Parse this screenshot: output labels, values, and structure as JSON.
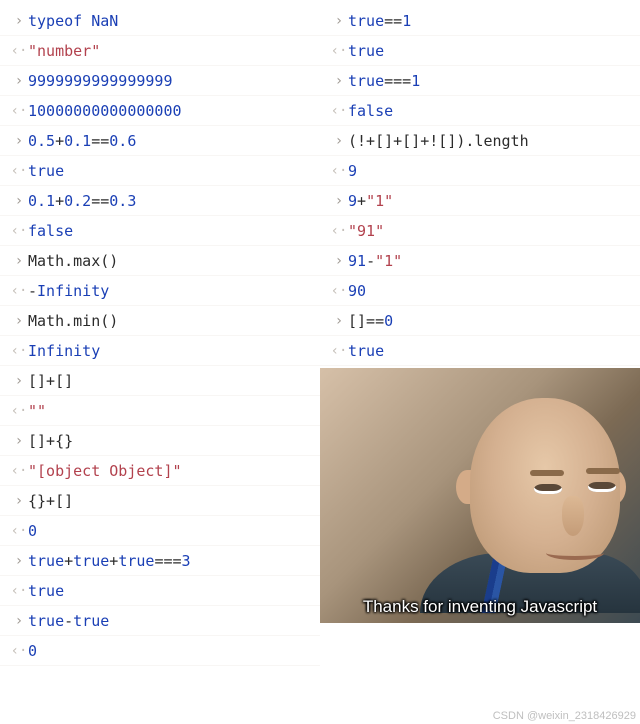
{
  "left": [
    {
      "kind": "in",
      "segments": [
        {
          "t": "kw",
          "v": "typeof"
        },
        {
          "t": "plain",
          "v": " "
        },
        {
          "t": "bool",
          "v": "NaN"
        }
      ]
    },
    {
      "kind": "out",
      "segments": [
        {
          "t": "str",
          "v": "\"number\""
        }
      ]
    },
    {
      "kind": "in",
      "segments": [
        {
          "t": "num",
          "v": "9999999999999999"
        }
      ]
    },
    {
      "kind": "out",
      "segments": [
        {
          "t": "num",
          "v": "10000000000000000"
        }
      ]
    },
    {
      "kind": "in",
      "segments": [
        {
          "t": "num",
          "v": "0.5"
        },
        {
          "t": "plain",
          "v": "+"
        },
        {
          "t": "num",
          "v": "0.1"
        },
        {
          "t": "plain",
          "v": "=="
        },
        {
          "t": "num",
          "v": "0.6"
        }
      ]
    },
    {
      "kind": "out",
      "segments": [
        {
          "t": "bool",
          "v": "true"
        }
      ]
    },
    {
      "kind": "in",
      "segments": [
        {
          "t": "num",
          "v": "0.1"
        },
        {
          "t": "plain",
          "v": "+"
        },
        {
          "t": "num",
          "v": "0.2"
        },
        {
          "t": "plain",
          "v": "=="
        },
        {
          "t": "num",
          "v": "0.3"
        }
      ]
    },
    {
      "kind": "out",
      "segments": [
        {
          "t": "bool",
          "v": "false"
        }
      ]
    },
    {
      "kind": "in",
      "segments": [
        {
          "t": "plain",
          "v": "Math.max()"
        }
      ]
    },
    {
      "kind": "out",
      "segments": [
        {
          "t": "plain",
          "v": "-"
        },
        {
          "t": "bool",
          "v": "Infinity"
        }
      ]
    },
    {
      "kind": "in",
      "segments": [
        {
          "t": "plain",
          "v": "Math.min()"
        }
      ]
    },
    {
      "kind": "out",
      "segments": [
        {
          "t": "bool",
          "v": "Infinity"
        }
      ]
    },
    {
      "kind": "in",
      "segments": [
        {
          "t": "plain",
          "v": "[]+[]"
        }
      ]
    },
    {
      "kind": "out",
      "segments": [
        {
          "t": "str",
          "v": "\"\""
        }
      ]
    },
    {
      "kind": "in",
      "segments": [
        {
          "t": "plain",
          "v": "[]+{}"
        }
      ]
    },
    {
      "kind": "out",
      "segments": [
        {
          "t": "str",
          "v": "\"[object Object]\""
        }
      ]
    },
    {
      "kind": "in",
      "segments": [
        {
          "t": "plain",
          "v": "{}+[]"
        }
      ]
    },
    {
      "kind": "out",
      "segments": [
        {
          "t": "num",
          "v": "0"
        }
      ]
    },
    {
      "kind": "in",
      "segments": [
        {
          "t": "bool",
          "v": "true"
        },
        {
          "t": "plain",
          "v": "+"
        },
        {
          "t": "bool",
          "v": "true"
        },
        {
          "t": "plain",
          "v": "+"
        },
        {
          "t": "bool",
          "v": "true"
        },
        {
          "t": "plain",
          "v": "==="
        },
        {
          "t": "num",
          "v": "3"
        }
      ]
    },
    {
      "kind": "out",
      "segments": [
        {
          "t": "bool",
          "v": "true"
        }
      ]
    },
    {
      "kind": "in",
      "segments": [
        {
          "t": "bool",
          "v": "true"
        },
        {
          "t": "plain",
          "v": "-"
        },
        {
          "t": "bool",
          "v": "true"
        }
      ]
    },
    {
      "kind": "out",
      "segments": [
        {
          "t": "num",
          "v": "0"
        }
      ]
    }
  ],
  "right": [
    {
      "kind": "in",
      "segments": [
        {
          "t": "bool",
          "v": "true"
        },
        {
          "t": "plain",
          "v": "=="
        },
        {
          "t": "num",
          "v": "1"
        }
      ]
    },
    {
      "kind": "out",
      "segments": [
        {
          "t": "bool",
          "v": "true"
        }
      ]
    },
    {
      "kind": "in",
      "segments": [
        {
          "t": "bool",
          "v": "true"
        },
        {
          "t": "plain",
          "v": "==="
        },
        {
          "t": "num",
          "v": "1"
        }
      ]
    },
    {
      "kind": "out",
      "segments": [
        {
          "t": "bool",
          "v": "false"
        }
      ]
    },
    {
      "kind": "in",
      "segments": [
        {
          "t": "plain",
          "v": "(!+[]+[]+![]).length"
        }
      ]
    },
    {
      "kind": "out",
      "segments": [
        {
          "t": "num",
          "v": "9"
        }
      ]
    },
    {
      "kind": "in",
      "segments": [
        {
          "t": "num",
          "v": "9"
        },
        {
          "t": "plain",
          "v": "+"
        },
        {
          "t": "str",
          "v": "\"1\""
        }
      ]
    },
    {
      "kind": "out",
      "segments": [
        {
          "t": "str",
          "v": "\"91\""
        }
      ]
    },
    {
      "kind": "in",
      "segments": [
        {
          "t": "num",
          "v": "91"
        },
        {
          "t": "plain",
          "v": "-"
        },
        {
          "t": "str",
          "v": "\"1\""
        }
      ]
    },
    {
      "kind": "out",
      "segments": [
        {
          "t": "num",
          "v": "90"
        }
      ]
    },
    {
      "kind": "in",
      "segments": [
        {
          "t": "plain",
          "v": "[]=="
        },
        {
          "t": "num",
          "v": "0"
        }
      ]
    },
    {
      "kind": "out",
      "segments": [
        {
          "t": "bool",
          "v": "true"
        }
      ]
    }
  ],
  "meme": {
    "caption": "Thanks for inventing Javascript"
  },
  "watermark": "CSDN @weixin_2318426929",
  "glyphs": {
    "in": "›",
    "out": "‹·"
  }
}
